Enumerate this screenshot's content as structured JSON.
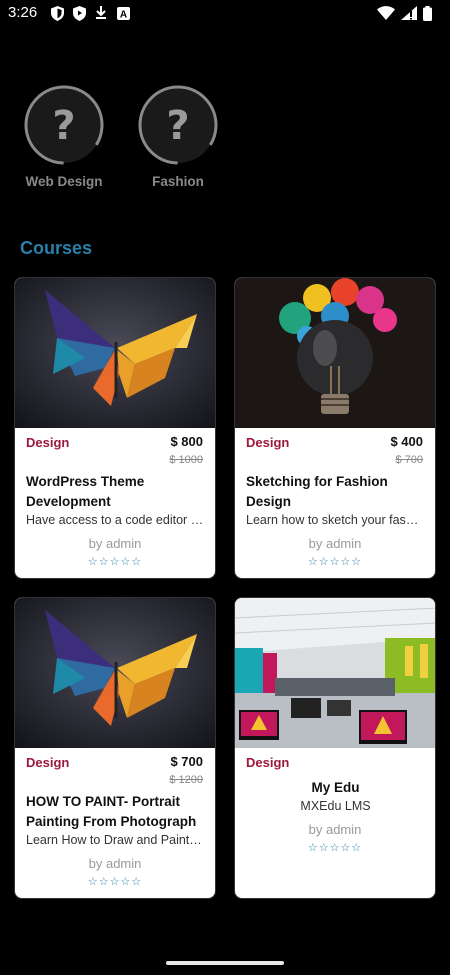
{
  "status_bar": {
    "time": "3:26"
  },
  "categories": [
    {
      "label": "Web Design"
    },
    {
      "label": "Fashion"
    }
  ],
  "section": {
    "title": "Courses"
  },
  "courses": [
    {
      "category": "Design",
      "price": "$ 800",
      "old_price": "$ 1000",
      "title": "WordPress Theme Development",
      "subtitle": "Have access to a code editor and ...",
      "author": "by admin",
      "stars": "☆☆☆☆☆",
      "image": "butterfly"
    },
    {
      "category": "Design",
      "price": "$ 400",
      "old_price": "$ 700",
      "title": "Sketching for Fashion Design",
      "subtitle": "Learn how to sketch your fashion ideas",
      "author": "by admin",
      "stars": "☆☆☆☆☆",
      "image": "bulb"
    },
    {
      "category": "Design",
      "price": "$ 700",
      "old_price": "$ 1200",
      "title": "HOW TO PAINT- Portrait Painting From Photograph",
      "subtitle": "Learn How to Draw and Paint Portraits",
      "author": "by admin",
      "stars": "☆☆☆☆☆",
      "image": "butterfly"
    },
    {
      "category": "Design",
      "title": "My Edu",
      "subtitle": "MXEdu LMS",
      "author": "by admin",
      "stars": "☆☆☆☆☆",
      "image": "classroom"
    }
  ]
}
